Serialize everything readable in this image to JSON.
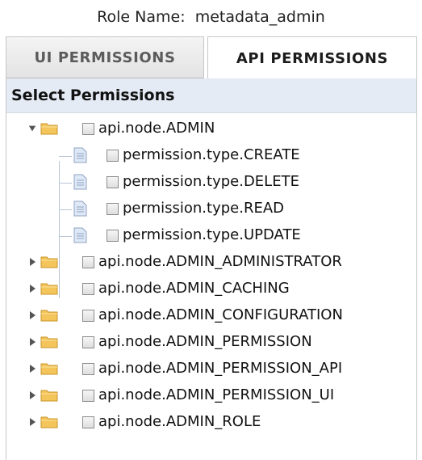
{
  "role": {
    "label": "Role Name:",
    "value": "metadata_admin"
  },
  "tabs": [
    {
      "label": "UI PERMISSIONS",
      "active": false
    },
    {
      "label": "API PERMISSIONS",
      "active": true
    }
  ],
  "panel": {
    "header": "Select Permissions"
  },
  "tree": {
    "expanded_node": {
      "label": "api.node.ADMIN",
      "expanded": true,
      "checked": false,
      "children": [
        {
          "label": "permission.type.CREATE",
          "checked": false
        },
        {
          "label": "permission.type.DELETE",
          "checked": false
        },
        {
          "label": "permission.type.READ",
          "checked": false
        },
        {
          "label": "permission.type.UPDATE",
          "checked": false
        }
      ]
    },
    "collapsed_nodes": [
      {
        "label": "api.node.ADMIN_ADMINISTRATOR",
        "checked": false
      },
      {
        "label": "api.node.ADMIN_CACHING",
        "checked": false
      },
      {
        "label": "api.node.ADMIN_CONFIGURATION",
        "checked": false
      },
      {
        "label": "api.node.ADMIN_PERMISSION",
        "checked": false
      },
      {
        "label": "api.node.ADMIN_PERMISSION_API",
        "checked": false
      },
      {
        "label": "api.node.ADMIN_PERMISSION_UI",
        "checked": false
      },
      {
        "label": "api.node.ADMIN_ROLE",
        "checked": false
      }
    ]
  },
  "icons": {
    "expanded": "triangle-down-icon",
    "collapsed": "triangle-right-icon",
    "folder": "folder-icon",
    "leaf": "document-icon"
  },
  "colors": {
    "header_bg": "#e4ebf5",
    "folder": "#f3c55a",
    "document": "#c8d9f0",
    "tree_line": "#b8c4d6",
    "tab_border": "#c7c7c7"
  }
}
